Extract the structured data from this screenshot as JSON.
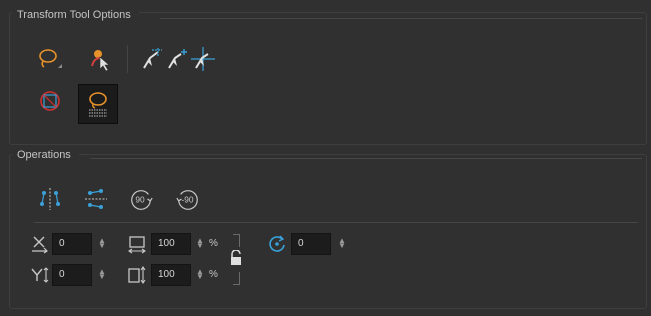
{
  "transform_group": {
    "title": "Transform Tool Options",
    "tools": [
      {
        "icon": "lasso-select-icon",
        "selected": false
      },
      {
        "icon": "select-by-color-icon",
        "selected": false
      },
      {
        "icon": "snap-to-contour-icon",
        "selected": false
      },
      {
        "icon": "snap-and-align-icon",
        "selected": false
      },
      {
        "icon": "marquee-select-icon",
        "selected": false
      },
      {
        "icon": "lasso-mode-icon",
        "selected": true
      }
    ]
  },
  "operations_group": {
    "title": "Operations",
    "buttons": [
      {
        "icon": "flip-horizontal-icon"
      },
      {
        "icon": "flip-vertical-icon"
      },
      {
        "icon": "rotate-90-cw-icon",
        "glyph": "90"
      },
      {
        "icon": "rotate-90-ccw-icon",
        "glyph": "-90"
      }
    ],
    "position_x": {
      "icon": "x-position-icon",
      "value": "0"
    },
    "position_y": {
      "icon": "y-position-icon",
      "value": "0"
    },
    "width": {
      "icon": "width-icon",
      "value": "100",
      "unit": "%"
    },
    "height": {
      "icon": "height-icon",
      "value": "100",
      "unit": "%"
    },
    "lock": {
      "icon": "lock-icon"
    },
    "angle": {
      "icon": "rotate-angle-icon",
      "value": "0"
    }
  },
  "colors": {
    "accent_orange": "#e8922a",
    "accent_blue": "#3aa0d8",
    "lock_red": "#d03030"
  }
}
